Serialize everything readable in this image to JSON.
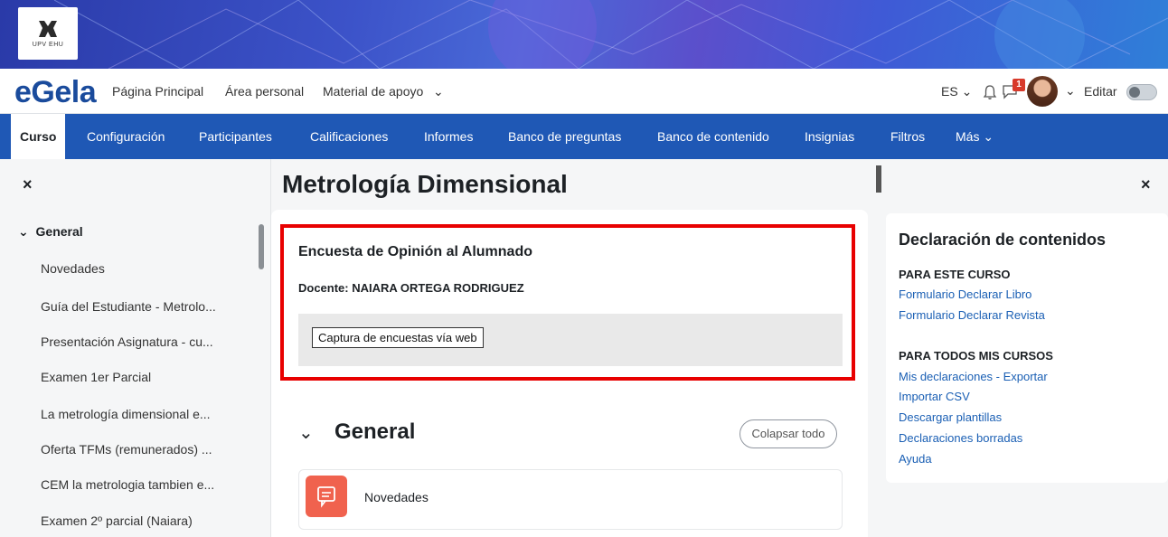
{
  "branding": {
    "logo_text": "UPV EHU",
    "app_name": "eGela"
  },
  "topnav": {
    "links": [
      "Página Principal",
      "Área personal",
      "Material de apoyo"
    ],
    "language": "ES",
    "notification_count": "1",
    "edit_label": "Editar"
  },
  "course_nav": {
    "tabs": [
      "Curso",
      "Configuración",
      "Participantes",
      "Calificaciones",
      "Informes",
      "Banco de preguntas",
      "Banco de contenido",
      "Insignias",
      "Filtros",
      "Más"
    ]
  },
  "course_index": {
    "section": "General",
    "items": [
      "Novedades",
      "Guía del Estudiante - Metrolo...",
      "Presentación Asignatura - cu...",
      "Examen 1er Parcial",
      "La metrología dimensional e...",
      "Oferta TFMs (remunerados) ...",
      "CEM la metrologia tambien e...",
      "Examen 2º parcial (Naiara)"
    ]
  },
  "main": {
    "course_title": "Metrología Dimensional",
    "survey": {
      "title": "Encuesta de Opinión al Alumnado",
      "teacher": "Docente: NAIARA ORTEGA RODRIGUEZ",
      "button": "Captura de encuestas vía web"
    },
    "section_title": "General",
    "collapse_all": "Colapsar todo",
    "activity_name": "Novedades"
  },
  "block": {
    "title": "Declaración de contenidos",
    "this_course_heading": "PARA ESTE CURSO",
    "this_course_links": [
      "Formulario Declarar Libro",
      "Formulario Declarar Revista"
    ],
    "all_courses_heading": "PARA TODOS MIS CURSOS",
    "all_courses_links": [
      "Mis declaraciones - Exportar",
      "Importar CSV",
      "Descargar plantillas",
      "Declaraciones borradas",
      "Ayuda"
    ]
  },
  "colors": {
    "brand_blue": "#1a4b9c",
    "nav_blue": "#1f58b5",
    "highlight_red": "#e80000",
    "activity_icon": "#f0624e",
    "link_blue": "#1a5fb4"
  }
}
